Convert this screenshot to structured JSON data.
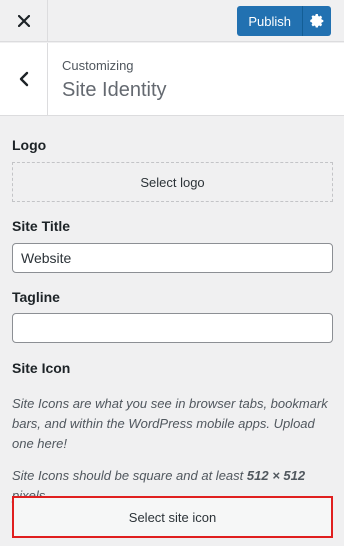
{
  "topbar": {
    "close_icon": "close-icon",
    "publish_label": "Publish",
    "gear_icon": "gear-icon",
    "accent": "#2271b1"
  },
  "section": {
    "back_icon": "chevron-left-icon",
    "context": "Customizing",
    "title": "Site Identity"
  },
  "logo": {
    "label": "Logo",
    "button": "Select logo"
  },
  "site_title": {
    "label": "Site Title",
    "value": "Website",
    "placeholder": ""
  },
  "tagline": {
    "label": "Tagline",
    "value": "",
    "placeholder": ""
  },
  "site_icon": {
    "label": "Site Icon",
    "description": "Site Icons are what you see in browser tabs, bookmark bars, and within the WordPress mobile apps. Upload one here!",
    "size_note_prefix": "Site Icons should be square and at least ",
    "size_note_value": "512 × 512",
    "size_note_suffix": " pixels.",
    "button": "Select site icon",
    "highlight_color": "#e01f1f"
  }
}
